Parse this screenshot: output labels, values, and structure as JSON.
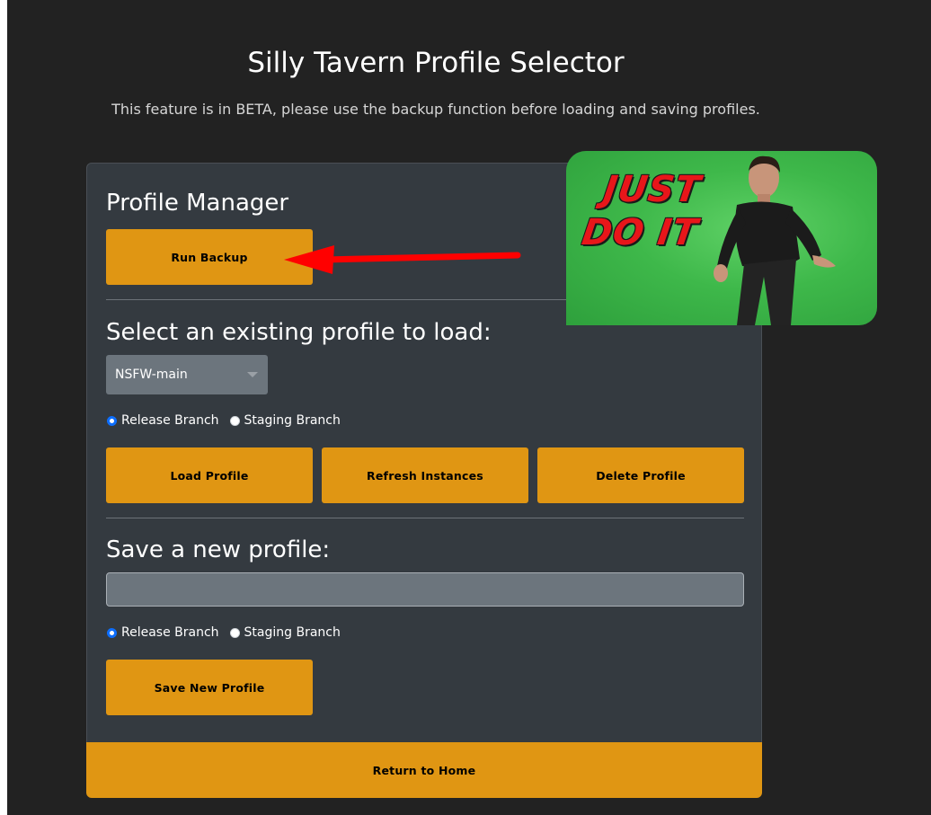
{
  "header": {
    "title": "Silly Tavern Profile Selector",
    "subtitle": "This feature is in BETA, please use the backup function before loading and saving profiles."
  },
  "manager": {
    "heading": "Profile Manager",
    "backup_label": "Run Backup"
  },
  "load": {
    "heading": "Select an existing profile to load:",
    "selected_profile": "NSFW-main",
    "branches": [
      {
        "label": "Release Branch",
        "checked": true
      },
      {
        "label": "Staging Branch",
        "checked": false
      }
    ],
    "buttons": {
      "load_label": "Load Profile",
      "refresh_label": "Refresh Instances",
      "delete_label": "Delete Profile"
    }
  },
  "save": {
    "heading": "Save a new profile:",
    "input_value": "",
    "branches": [
      {
        "label": "Release Branch",
        "checked": true
      },
      {
        "label": "Staging Branch",
        "checked": false
      }
    ],
    "save_label": "Save New Profile"
  },
  "footer": {
    "home_label": "Return to Home"
  },
  "meme": {
    "line1": "JUST",
    "line2": "DO IT"
  },
  "colors": {
    "accent": "#e09613",
    "card": "#343a40",
    "background": "#222222",
    "arrow": "#ff0000"
  }
}
